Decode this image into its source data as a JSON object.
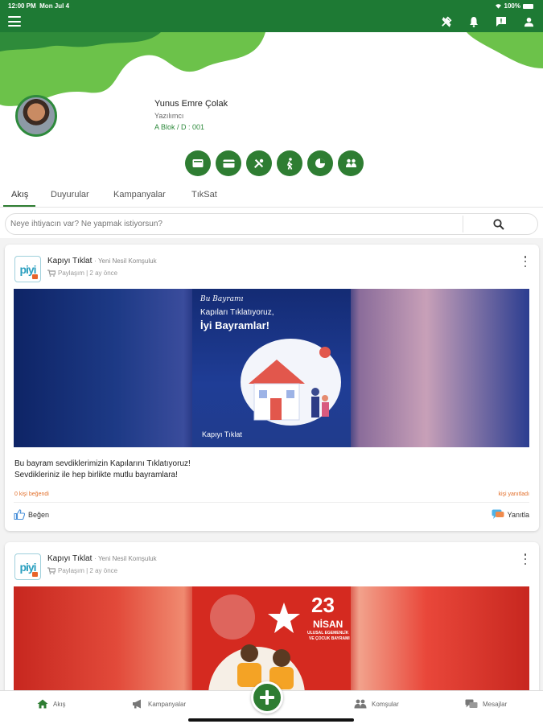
{
  "status_bar": {
    "time": "12:00 PM",
    "date": "Mon Jul 4",
    "battery": "100%"
  },
  "header": {
    "icons": [
      "menu-icon",
      "tools-icon",
      "bell-icon",
      "message-icon",
      "person-icon"
    ],
    "colors": {
      "primary": "#1e7a34",
      "accent_light": "#6cc24a"
    }
  },
  "profile": {
    "name": "Yunus Emre Çolak",
    "role": "Yazılımcı",
    "flat": "A Blok / D : 001",
    "quick_actions": [
      "wallet-icon",
      "card-icon",
      "tools-icon",
      "walking-icon",
      "pie-chart-icon",
      "handshake-icon"
    ]
  },
  "tabs": [
    {
      "label": "Akış",
      "active": true
    },
    {
      "label": "Duyurular"
    },
    {
      "label": "Kampanyalar"
    },
    {
      "label": "TıkSat"
    }
  ],
  "search": {
    "placeholder": "Neye ihtiyacın var? Ne yapmak istiyorsun?"
  },
  "posts": [
    {
      "author": "Kapıyı Tıklat",
      "source": "Yeni Nesil Komşuluk",
      "meta": "Paylaşım | 2 ay önce",
      "logo_text": "piyi",
      "image_title_script": "Bu Bayramı",
      "image_title": "Kapıları Tıklatıyoruz,",
      "image_title_bold": "İyi Bayramlar!",
      "image_brand": "Kapıyı Tıklat",
      "text_line1": "Bu bayram sevdiklerimizin Kapılarını Tıklatıyoruz!",
      "text_line2": "Sevdikleriniz ile hep birlikte mutlu bayramlara!",
      "likes_left": "0 kişi beğendi",
      "likes_right": "kişi yanıtladı",
      "like_label": "Beğen",
      "reply_label": "Yanıtla"
    },
    {
      "author": "Kapıyı Tıklat",
      "source": "Yeni Nesil Komşuluk",
      "meta": "Paylaşım | 2 ay önce",
      "logo_text": "piyi",
      "image_day": "23",
      "image_month": "NİSAN",
      "image_sub1": "ULUSAL EGEMENLİK",
      "image_sub2": "VE ÇOCUK BAYRAMI"
    }
  ],
  "bottom_nav": {
    "items": [
      {
        "label": "Akış",
        "icon": "home-icon"
      },
      {
        "label": "Kampanyalar",
        "icon": "megaphone-icon"
      },
      {
        "label": "Komşular",
        "icon": "people-icon"
      },
      {
        "label": "Mesajlar",
        "icon": "chat-icon"
      }
    ],
    "fab_icon": "plus-icon"
  }
}
